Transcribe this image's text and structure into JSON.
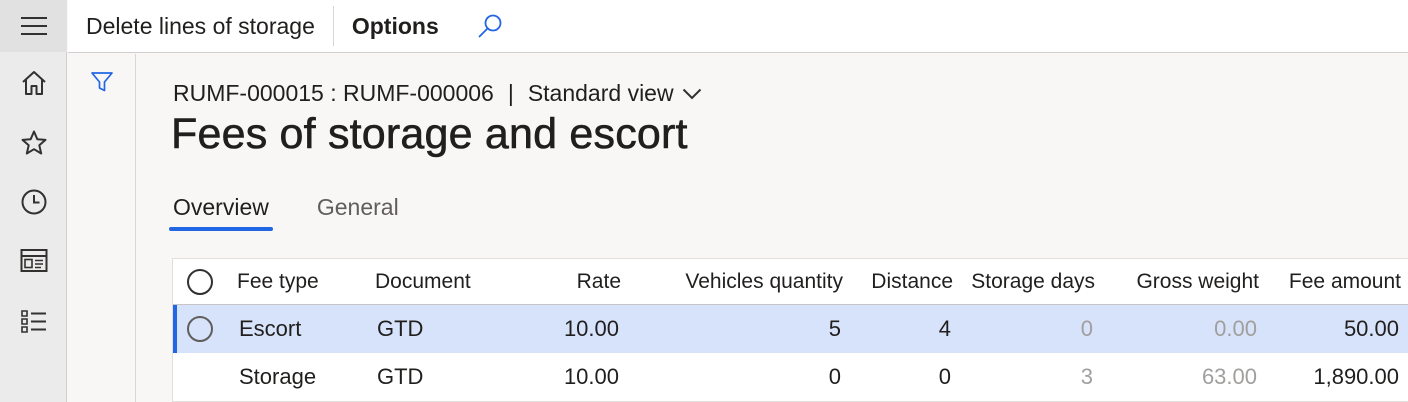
{
  "nav_rail": {
    "items": [
      {
        "icon": "hamburger-icon"
      },
      {
        "icon": "home-icon"
      },
      {
        "icon": "star-icon"
      },
      {
        "icon": "clock-icon"
      },
      {
        "icon": "workspace-icon"
      },
      {
        "icon": "list-icon"
      }
    ]
  },
  "actionbar": {
    "delete_label": "Delete lines of storage",
    "options_label": "Options",
    "search_icon": "search-icon"
  },
  "filter": {
    "icon": "filter-icon"
  },
  "page": {
    "breadcrumb_record": "RUMF-000015 : RUMF-000006",
    "breadcrumb_sep": "|",
    "view_label": "Standard view",
    "title": "Fees of storage and escort"
  },
  "tabs": [
    {
      "label": "Overview",
      "active": true
    },
    {
      "label": "General",
      "active": false
    }
  ],
  "grid": {
    "columns": [
      "Fee type",
      "Document",
      "Rate",
      "Vehicles quantity",
      "Distance",
      "Storage days",
      "Gross weight",
      "Fee amount"
    ],
    "rows": [
      {
        "fee_type": "Escort",
        "document": "GTD",
        "rate": "10.00",
        "vehicles_quantity": "5",
        "distance": "4",
        "storage_days": "0",
        "gross_weight": "0.00",
        "fee_amount": "50.00",
        "selected": true
      },
      {
        "fee_type": "Storage",
        "document": "GTD",
        "rate": "10.00",
        "vehicles_quantity": "0",
        "distance": "0",
        "storage_days": "3",
        "gross_weight": "63.00",
        "fee_amount": "1,890.00",
        "selected": false
      }
    ]
  },
  "colors": {
    "accent": "#2266e3",
    "selected_row": "#d7e3fa",
    "disabled_text": "#a19f9d"
  }
}
